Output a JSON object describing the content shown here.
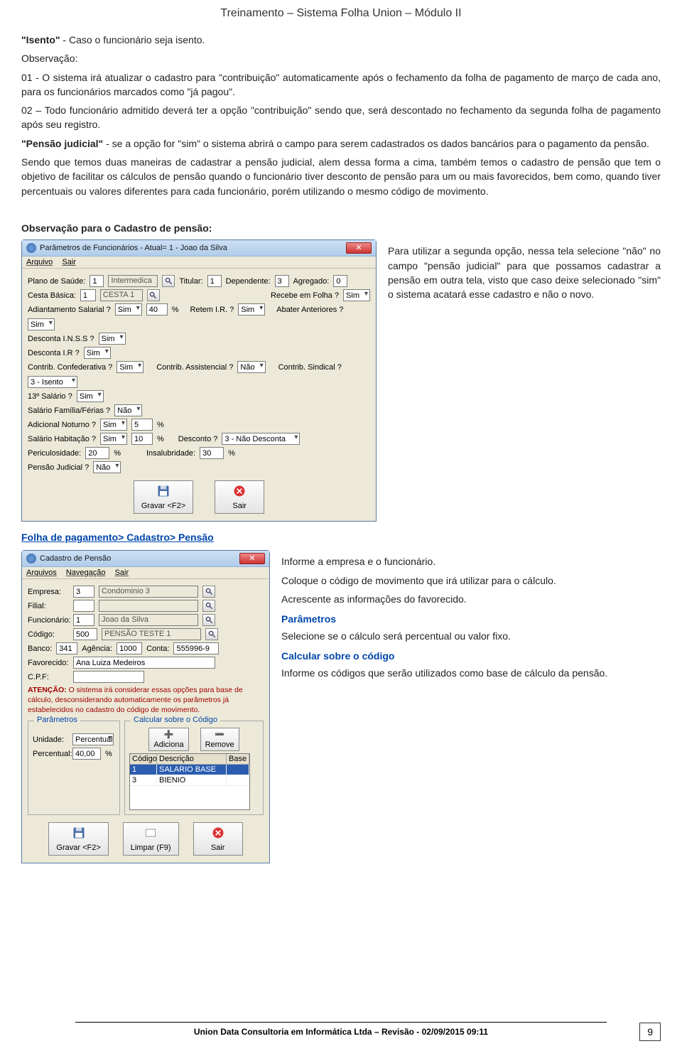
{
  "header": {
    "title": "Treinamento – Sistema Folha Union – Módulo II"
  },
  "p1": {
    "prefix": "\"Isento\"",
    "rest": " - Caso o funcionário seja isento."
  },
  "p2": "Observação:",
  "p3": "01 - O sistema irá atualizar o cadastro para \"contribuição\" automaticamente após o fechamento da folha de pagamento de março de cada ano, para os funcionários marcados como \"já pagou\".",
  "p4": "02 – Todo funcionário admitido deverá ter a opção \"contribuição\" sendo que, será descontado no fechamento da segunda folha de pagamento após seu registro.",
  "p5": {
    "prefix": "\"Pensão judicial\"",
    "rest": " - se a opção for \"sim\" o sistema abrirá o campo para serem cadastrados os dados bancários para o pagamento da pensão."
  },
  "p6": "Sendo que temos duas maneiras de cadastrar a pensão judicial, alem dessa forma a cima, também temos o cadastro de pensão que tem o objetivo de facilitar os cálculos de pensão quando o funcionário tiver desconto de pensão para um ou mais favorecidos, bem como, quando tiver percentuais ou valores diferentes para cada funcionário, porém utilizando o mesmo código de movimento.",
  "p7": "Observação para o Cadastro de pensão:",
  "side1": "Para utilizar a segunda opção, nessa tela selecione \"não\" no campo \"pensão judicial\" para que possamos cadastrar a pensão em outra tela, visto que caso deixe selecionado \"sim\" o sistema acatará esse cadastro e não o novo.",
  "nav1": "Folha de pagamento> Cadastro> Pensão",
  "side2a": "Informe a empresa e o funcionário.",
  "side2b": "Coloque o código de movimento que irá utilizar para o cálculo.",
  "side2c": "Acrescente as informações do favorecido.",
  "side2d_h": "Parâmetros",
  "side2d": "Selecione se o cálculo será percentual ou valor fixo.",
  "side2e_h": "Calcular sobre o código",
  "side2e": "Informe os códigos que serão utilizados como base de cálculo da pensão.",
  "footer": {
    "text": "Union Data Consultoria em Informática Ltda – Revisão - 02/09/2015 09:11",
    "page": "9"
  },
  "win1": {
    "title": "Parâmetros de Funcionários - Atual= 1 - Joao da Silva",
    "menu": {
      "arquivo": "Arquivo",
      "sair": "Sair"
    },
    "labels": {
      "plano": "Plano de Saúde:",
      "titular": "Titular:",
      "dependente": "Dependente:",
      "agregado": "Agregado:",
      "cesta": "Cesta Básica:",
      "recebe_folha": "Recebe em Folha ?",
      "adiant": "Adiantamento Salarial ?",
      "pct1": "%",
      "retem": "Retem I.R. ?",
      "abater": "Abater Anteriores ?",
      "inss": "Desconta I.N.S.S ?",
      "ir": "Desconta I.R ?",
      "confed": "Contrib. Confederativa ?",
      "assist": "Contrib. Assistencial ?",
      "sindical": "Contrib. Sindical ?",
      "sal13": "13º Salário ?",
      "salfam": "Salário Família/Férias ?",
      "adnot": "Adicional Noturno ?",
      "habit": "Salário Habitação ?",
      "desconto": "Desconto ?",
      "peric": "Periculosidade:",
      "insal": "Insalubridade:",
      "pensao": "Pensão Judicial ?"
    },
    "vals": {
      "plano_cod": "1",
      "plano_nome": "Intermedica",
      "titular": "1",
      "dependente": "3",
      "agregado": "0",
      "cesta_cod": "1",
      "cesta_nome": "CESTA 1",
      "recebe_folha": "Sim",
      "adiant": "Sim",
      "adiant_pct": "40",
      "retem": "Sim",
      "abater": "Sim",
      "inss": "Sim",
      "ir": "Sim",
      "confed": "Sim",
      "assist": "Não",
      "sindical": "3 - Isento",
      "sal13": "Sim",
      "salfam": "Não",
      "adnot": "Sim",
      "adnot_pct": "5",
      "habit": "Sim",
      "habit_pct": "10",
      "desconto": "3 - Não Desconta",
      "peric": "20",
      "insal": "30",
      "pensao": "Não"
    },
    "buttons": {
      "gravar": "Gravar <F2>",
      "sair": "Sair"
    }
  },
  "win2": {
    "title": "Cadastro de Pensão",
    "menu": {
      "arquivos": "Arquivos",
      "navegacao": "Navegação",
      "sair": "Sair"
    },
    "labels": {
      "empresa": "Empresa:",
      "filial": "Filial:",
      "func": "Funcionário:",
      "codigo": "Código:",
      "banco": "Banco:",
      "agencia": "Agência:",
      "conta": "Conta:",
      "favorecido": "Favorecido:",
      "cpf": "C.P.F:",
      "atencao_prefix": "ATENÇÃO:",
      "atencao": "O sistema irá considerar essas opções para base de cálculo, desconsiderando automaticamente os parâmetros já estabelecidos no cadastro do código de movimento.",
      "parametros": "Parâmetros",
      "calcular_sobre": "Calcular sobre o Código",
      "unidade": "Unidade:",
      "percentual": "Percentual:"
    },
    "vals": {
      "empresa": "3",
      "empresa_nome": "Condominio 3",
      "filial": "",
      "func": "1",
      "func_nome": "Joao da Silva",
      "codigo": "500",
      "codigo_nome": "PENSÃO TESTE 1",
      "banco": "341",
      "agencia": "1000",
      "conta": "555996-9",
      "favorecido": "Ana Luiza Medeiros",
      "cpf": "",
      "unidade": "Percentual",
      "percentual": "40,00"
    },
    "grid": {
      "h1": "Código",
      "h2": "Descrição",
      "h3": "Base",
      "r1_c": "1",
      "r1_d": "SALARIO BASE",
      "r2_c": "3",
      "r2_d": "BIENIO"
    },
    "buttons": {
      "adiciona": "Adiciona",
      "remove": "Remove",
      "gravar": "Gravar <F2>",
      "limpar": "Limpar (F9)",
      "sair": "Sair"
    }
  }
}
